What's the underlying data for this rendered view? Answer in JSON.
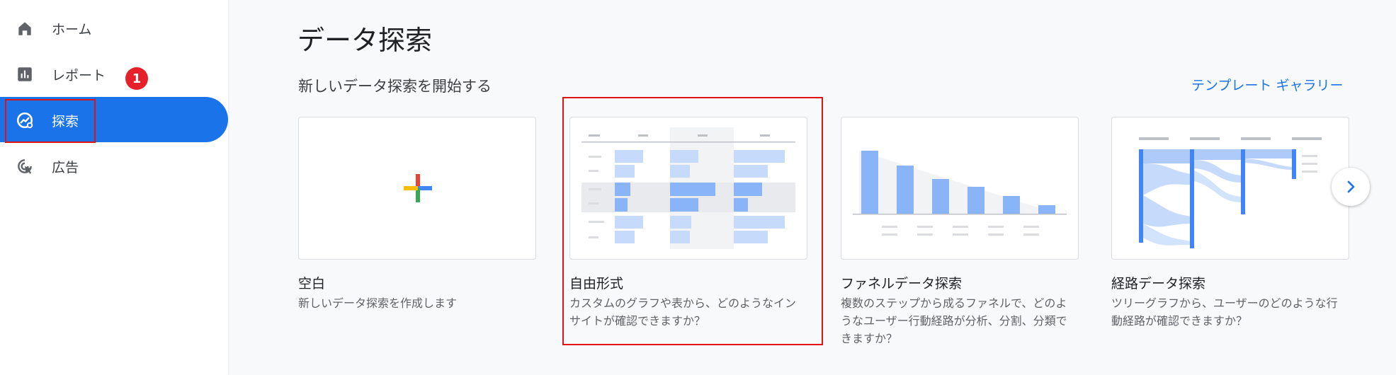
{
  "sidebar": {
    "items": [
      {
        "label": "ホーム",
        "icon": "home-icon"
      },
      {
        "label": "レポート",
        "icon": "bar-chart-icon"
      },
      {
        "label": "探索",
        "icon": "explore-icon"
      },
      {
        "label": "広告",
        "icon": "ads-cursor-icon"
      }
    ],
    "active_index": 2
  },
  "annotation": {
    "badge": "1",
    "highlight_color": "#e01414"
  },
  "main": {
    "title": "データ探索",
    "section_title": "新しいデータ探索を開始する",
    "gallery_link": "テンプレート ギャラリー",
    "cards": [
      {
        "title": "空白",
        "desc": "新しいデータ探索を作成します",
        "thumb": "plus-icon"
      },
      {
        "title": "自由形式",
        "desc": "カスタムのグラフや表から、どのようなインサイトが確認できますか？",
        "thumb": "freeform-table-thumbnail",
        "highlighted": true
      },
      {
        "title": "ファネルデータ探索",
        "desc": "複数のステップから成るファネルで、どのようなユーザー行動経路が分析、分割、分類できますか？",
        "thumb": "funnel-thumbnail"
      },
      {
        "title": "経路データ探索",
        "desc": "ツリーグラフから、ユーザーのどのような行動経路が確認できますか？",
        "thumb": "path-thumbnail"
      }
    ],
    "next_icon": "chevron-right-icon"
  },
  "colors": {
    "accent": "#1a73e8",
    "annotation_red": "#e01414",
    "background": "#f8f9fa",
    "bar_blue": "#8ab4f8"
  }
}
